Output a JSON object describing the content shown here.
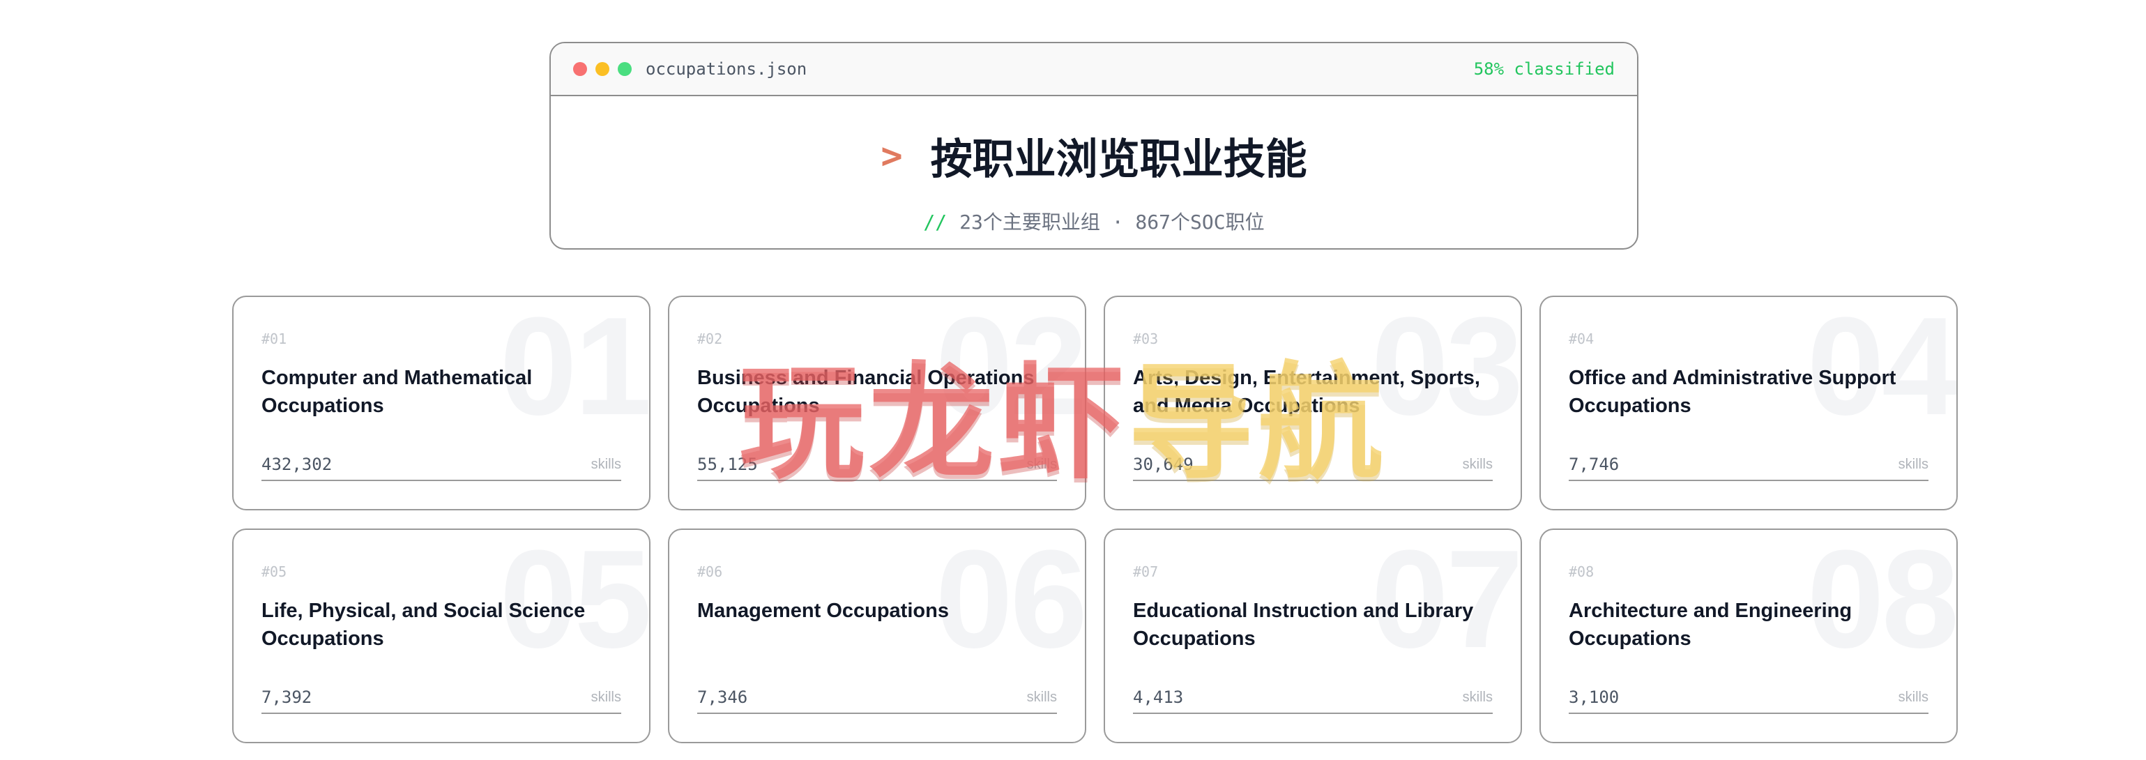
{
  "window": {
    "dots": [
      "#f87171",
      "#fbbf24",
      "#4ade80"
    ],
    "filename": "occupations.json",
    "status": "58% classified",
    "prompt": ">",
    "title": "按职业浏览职业技能",
    "subtitle_prefix": "//",
    "subtitle": "23个主要职业组 · 867个SOC职位"
  },
  "cards": [
    {
      "num": "#01",
      "bg": "01",
      "title": "Computer and Mathematical Occupations",
      "count": "432,302",
      "unit": "skills"
    },
    {
      "num": "#02",
      "bg": "02",
      "title": "Business and Financial Operations Occupations",
      "count": "55,125",
      "unit": "skills"
    },
    {
      "num": "#03",
      "bg": "03",
      "title": "Arts, Design, Entertainment, Sports, and Media Occupations",
      "count": "30,649",
      "unit": "skills"
    },
    {
      "num": "#04",
      "bg": "04",
      "title": "Office and Administrative Support Occupations",
      "count": "7,746",
      "unit": "skills"
    },
    {
      "num": "#05",
      "bg": "05",
      "title": "Life, Physical, and Social Science Occupations",
      "count": "7,392",
      "unit": "skills"
    },
    {
      "num": "#06",
      "bg": "06",
      "title": "Management Occupations",
      "count": "7,346",
      "unit": "skills"
    },
    {
      "num": "#07",
      "bg": "07",
      "title": "Educational Instruction and Library Occupations",
      "count": "4,413",
      "unit": "skills"
    },
    {
      "num": "#08",
      "bg": "08",
      "title": "Architecture and Engineering Occupations",
      "count": "3,100",
      "unit": "skills"
    }
  ],
  "watermark": {
    "text_red": "玩龙虾",
    "text_yellow": "导航"
  }
}
